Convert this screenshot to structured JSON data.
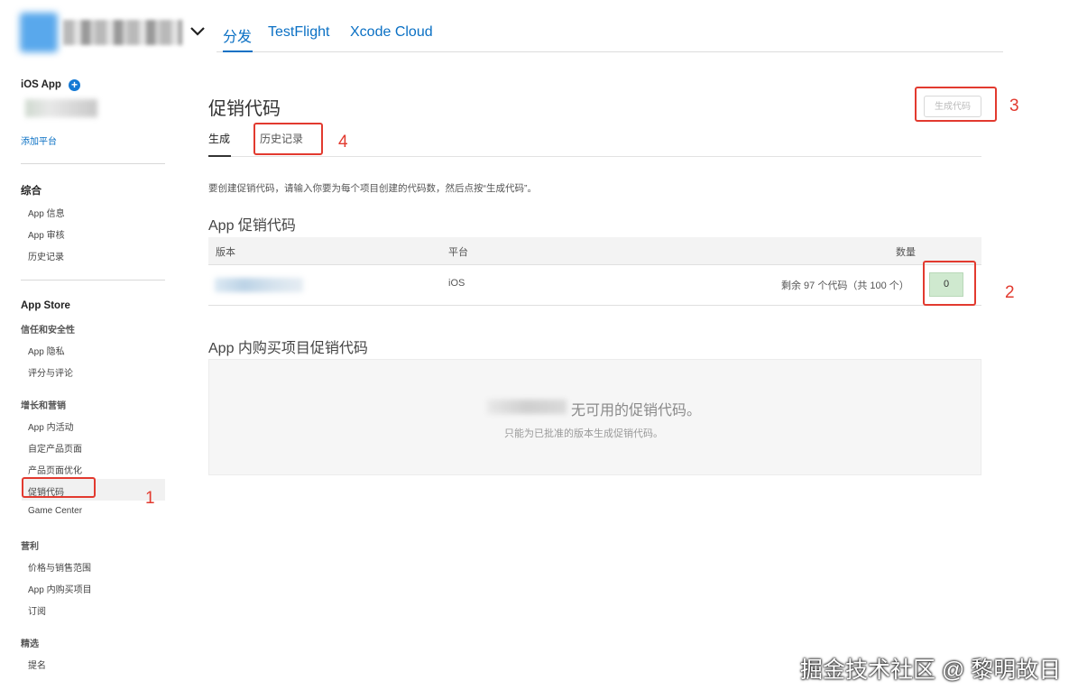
{
  "header": {
    "tabs": [
      {
        "label": "分发",
        "active": true
      },
      {
        "label": "TestFlight",
        "active": false
      },
      {
        "label": "Xcode Cloud",
        "active": false
      }
    ],
    "dropdown_icon": "chevron-down-icon"
  },
  "sidebar": {
    "platform_title": "iOS App",
    "add_platform": "添加平台",
    "sections": [
      {
        "title": "综合",
        "items": [
          "App 信息",
          "App 审核",
          "历史记录"
        ]
      },
      {
        "title": "App Store"
      },
      {
        "title": "信任和安全性",
        "items": [
          "App 隐私",
          "评分与评论"
        ]
      },
      {
        "title": "增长和营销",
        "items": [
          "App 内活动",
          "自定产品页面",
          "产品页面优化",
          "促销代码",
          "Game Center"
        ]
      },
      {
        "title": "营利",
        "items": [
          "价格与销售范围",
          "App 内购买项目",
          "订阅"
        ]
      },
      {
        "title": "精选",
        "items": [
          "提名"
        ]
      }
    ],
    "active_item": "促销代码"
  },
  "main": {
    "title": "促销代码",
    "generate_button": "生成代码",
    "tabs": [
      {
        "label": "生成",
        "active": true
      },
      {
        "label": "历史记录",
        "active": false
      }
    ],
    "description": "要创建促销代码，请输入你要为每个项目创建的代码数，然后点按“生成代码”。",
    "app_section": {
      "title": "App 促销代码",
      "columns": [
        "版本",
        "平台",
        "数量"
      ],
      "rows": [
        {
          "platform": "iOS",
          "remaining": "剩余 97 个代码（共 100 个）",
          "quantity": "0"
        }
      ]
    },
    "iap_section": {
      "title": "App 内购买项目促销代码",
      "empty_title": "无可用的促销代码。",
      "empty_subtitle": "只能为已批准的版本生成促销代码。"
    }
  },
  "annotations": {
    "labels": [
      "1",
      "2",
      "3",
      "4"
    ],
    "color": "#e23a2f"
  },
  "watermark": "掘金技术社区 @ 黎明故日",
  "colors": {
    "accent": "#0a70c4",
    "quantity_bg": "#cfe9cf",
    "annotation": "#e23a2f"
  }
}
